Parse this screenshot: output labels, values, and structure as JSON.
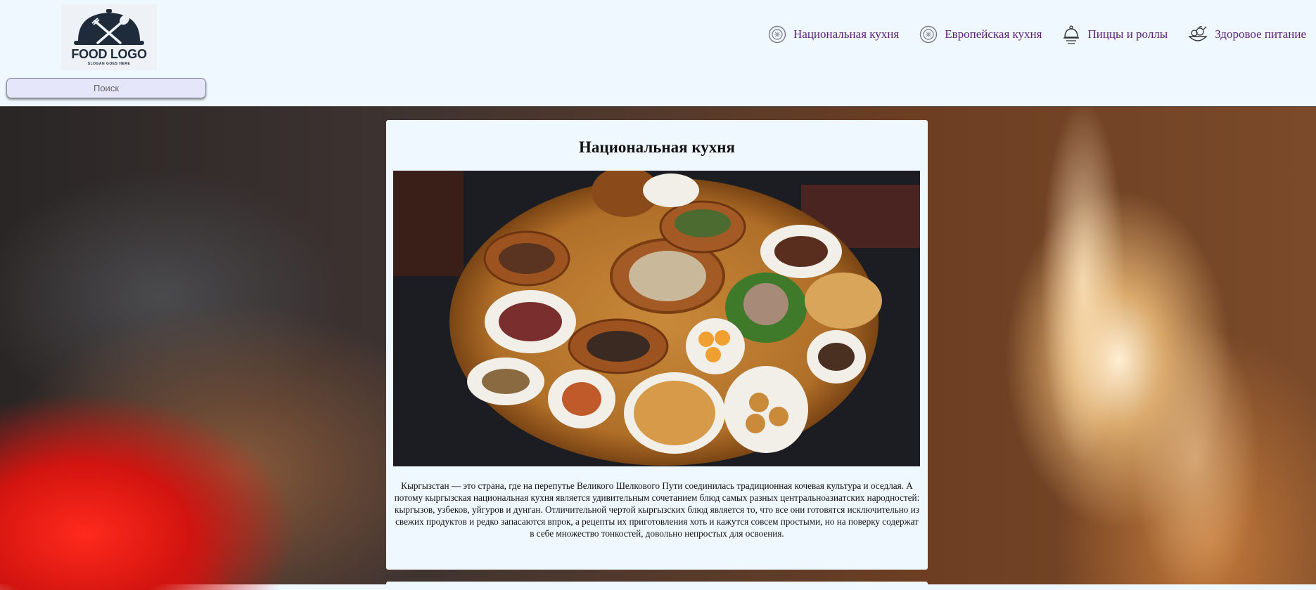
{
  "logo": {
    "title": "FOOD LOGO",
    "slogan": "SLOGAN GOES HERE",
    "icon": "cloche-fork-spoon-icon"
  },
  "search": {
    "placeholder": "Поиск",
    "value": ""
  },
  "nav": {
    "items": [
      {
        "label": "Национальная кухня",
        "icon": "plate-icon"
      },
      {
        "label": "Европейская кухня",
        "icon": "plate-icon"
      },
      {
        "label": "Пиццы и роллы",
        "icon": "serving-dish-icon"
      },
      {
        "label": "Здоровое питание",
        "icon": "vegetables-icon"
      }
    ],
    "color": "#5b1e7a"
  },
  "article": {
    "title": "Национальная кухня",
    "text": "Кыргызстан — это страна, где на перепутье Великого Шелкового Пути соединилась традиционная кочевая культура и оседлая. А потому кыргызская национальная кухня является удивительным сочетанием блюд самых разных центральноазиатских народностей: кыргызов, узбеков, уйгуров и дунган. Отличительной чертой кыргызских блюд является то, что все они готовятся исключительно из свежих продуктов и редко запасаются впрок, а рецепты их приготовления хоть и кажутся совсем простыми, но на поверку содержат в себе множество тонкостей, довольно непростых для освоения."
  },
  "colors": {
    "page_background": "#f0f8ff",
    "search_background": "#e6e6fa"
  }
}
